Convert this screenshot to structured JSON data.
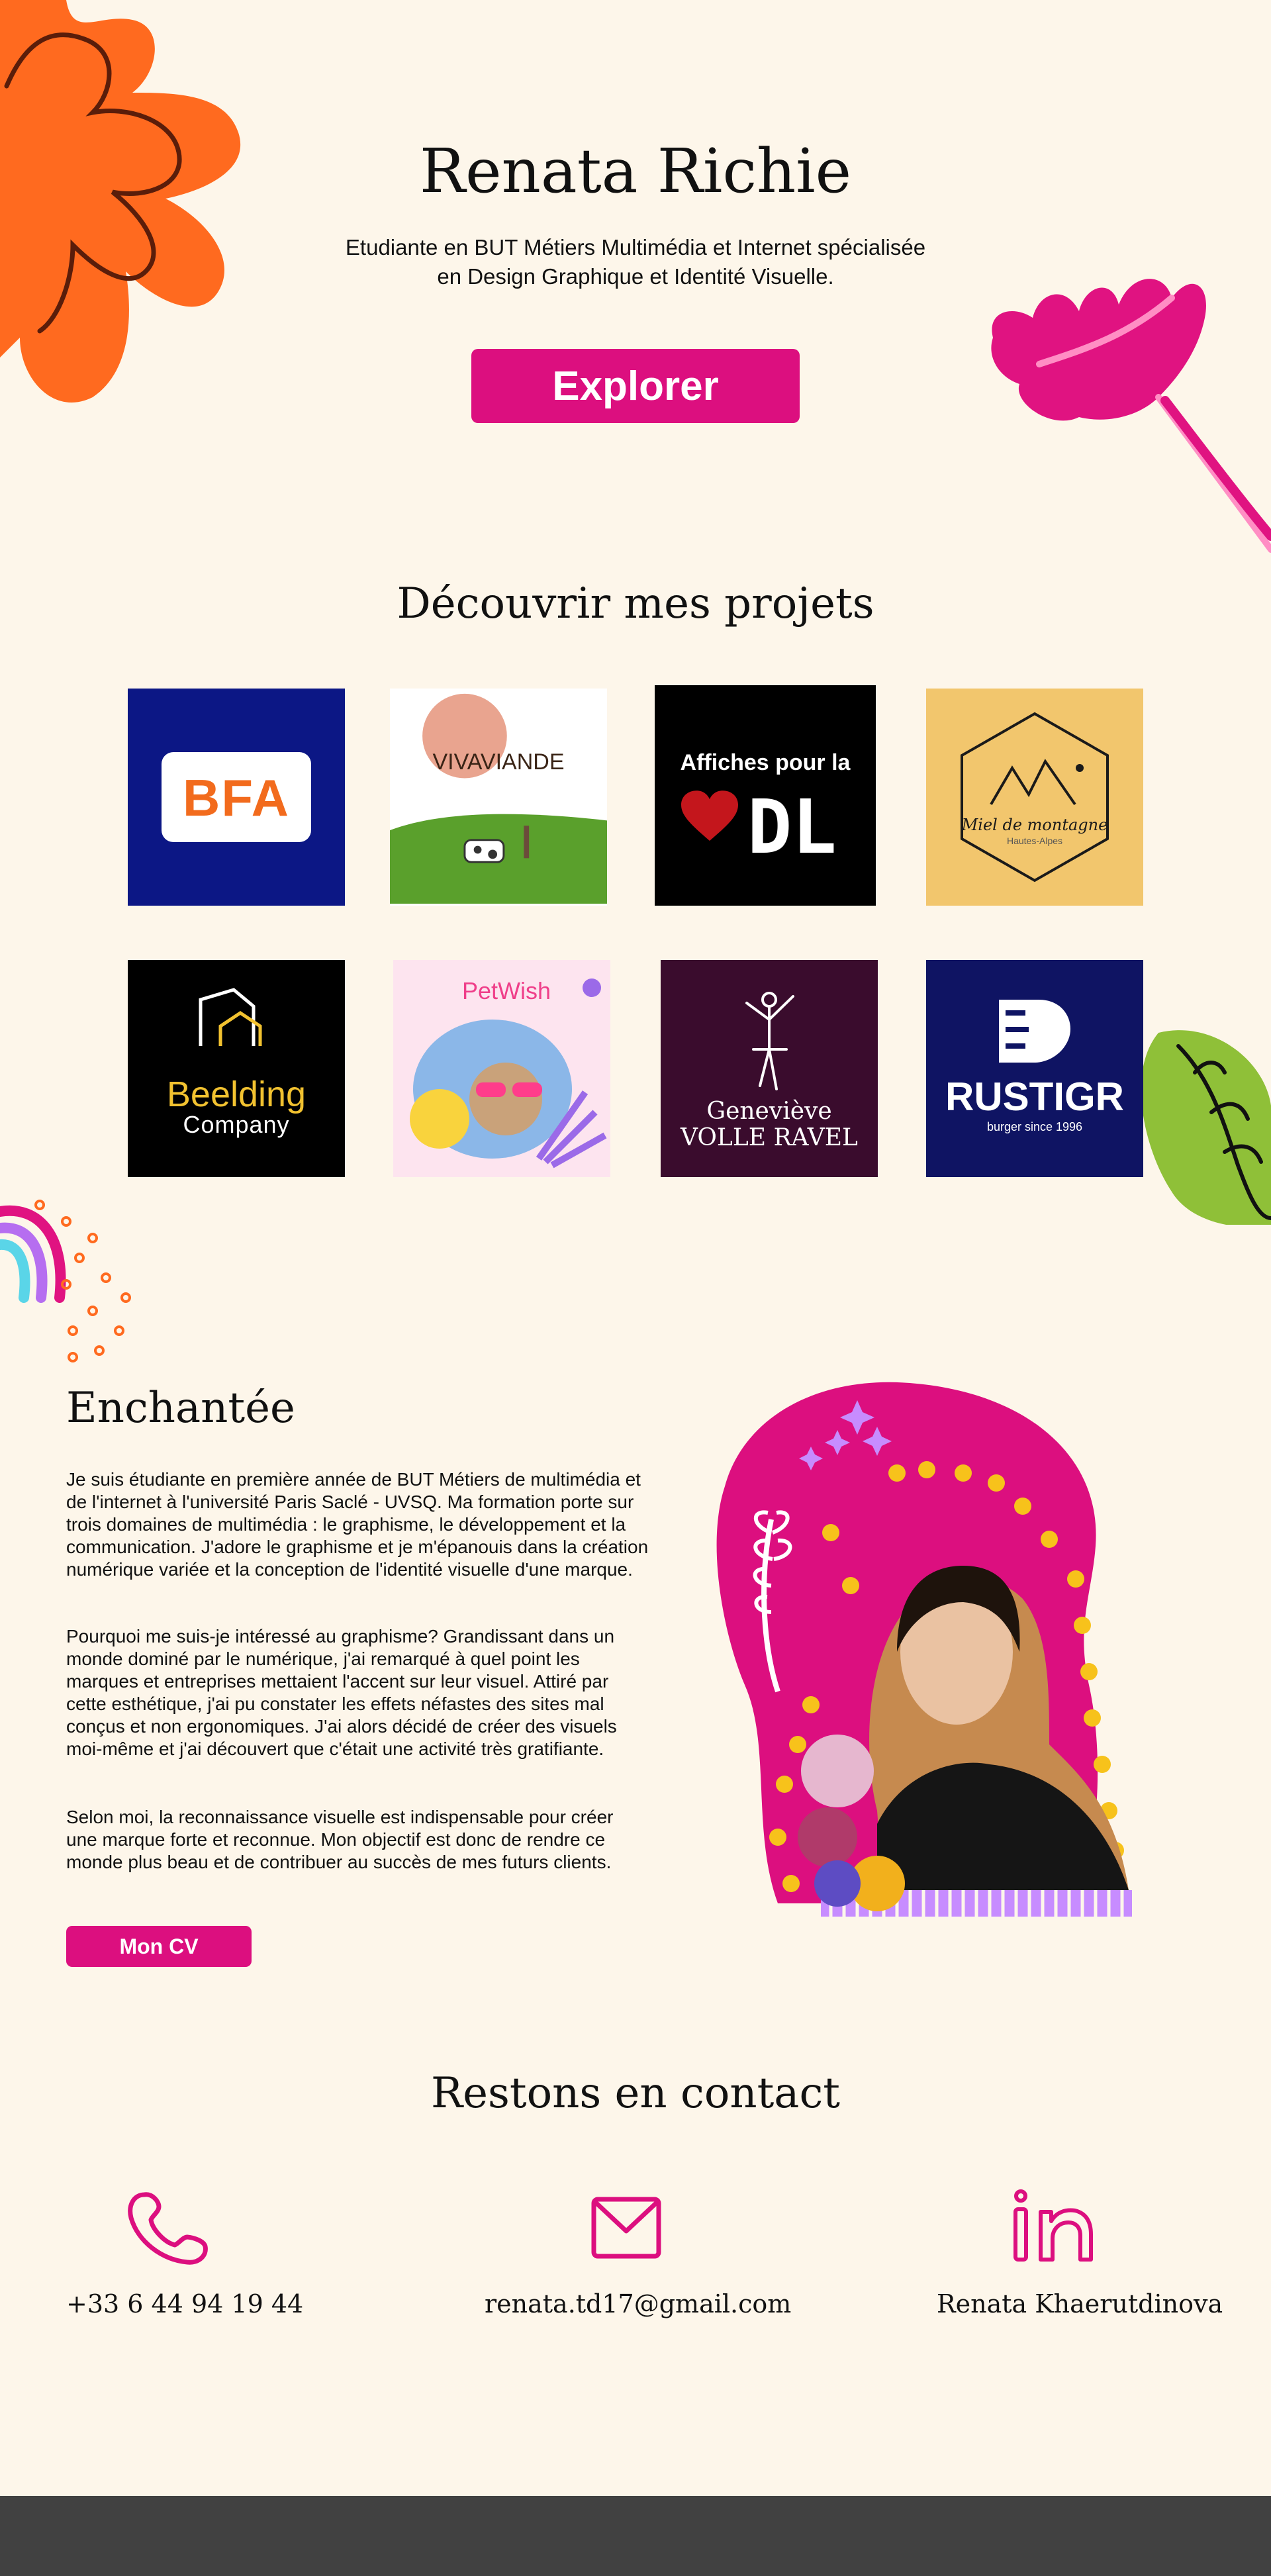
{
  "hero": {
    "title": "Renata Richie",
    "subtitle_line1": "Etudiante en BUT Métiers Multimédia et Internet spécialisée",
    "subtitle_line2": "en Design Graphique et Identité Visuelle.",
    "explore_label": "Explorer"
  },
  "projects": {
    "title": "Découvrir mes projets",
    "tiles": [
      {
        "text": "BFA",
        "bg": "#0c1785"
      },
      {
        "text": "VIVAVIANDE",
        "bg": "#ffffff"
      },
      {
        "text_top": "Affiches pour la",
        "text_main": "DL",
        "bg": "#000000"
      },
      {
        "text": "Miel de montagne",
        "sub": "Hautes-Alpes",
        "bg": "#f2c66d"
      },
      {
        "text": "Beelding",
        "sub": "Company",
        "bg": "#000000"
      },
      {
        "text": "PetWish",
        "bg": "#fde4ef"
      },
      {
        "text": "Geneviève",
        "sub": "VOLLE RAVEL",
        "bg": "#3a0c2d"
      },
      {
        "text": "RUSTIGR",
        "sub": "burger since 1996",
        "bg": "#0f1463"
      }
    ]
  },
  "about": {
    "title": "Enchantée",
    "p1": "Je suis étudiante en première année de BUT Métiers de multimédia et de l'internet à l'université Paris Saclé - UVSQ. Ma formation porte sur trois domaines de multimédia : le graphisme, le développement et la communication. J'adore le graphisme et je m'épanouis dans la création numérique variée et la conception de l'identité visuelle d'une marque.",
    "p2": "Pourquoi me suis-je intéressé au graphisme? Grandissant dans un monde dominé par le numérique, j'ai remarqué à quel point les marques et entreprises mettaient l'accent sur leur visuel. Attiré par cette esthétique, j'ai pu constater les effets néfastes des sites mal conçus et non ergonomiques. J'ai alors décidé de créer des visuels moi-même et j'ai découvert que c'était une activité très gratifiante.",
    "p3": "Selon moi, la reconnaissance visuelle est indispensable pour créer une marque forte et reconnue. Mon objectif est donc de rendre ce monde plus beau et de contribuer au succès de mes futurs clients.",
    "cv_label": "Mon CV"
  },
  "contact": {
    "title": "Restons en contact",
    "phone": "+33 6 44 94 19 44",
    "email": "renata.td17@gmail.com",
    "linkedin": "Renata Khaerutdinova"
  },
  "colors": {
    "accent": "#dc0f7f",
    "background": "#fdf6ea",
    "footer": "#414141"
  }
}
